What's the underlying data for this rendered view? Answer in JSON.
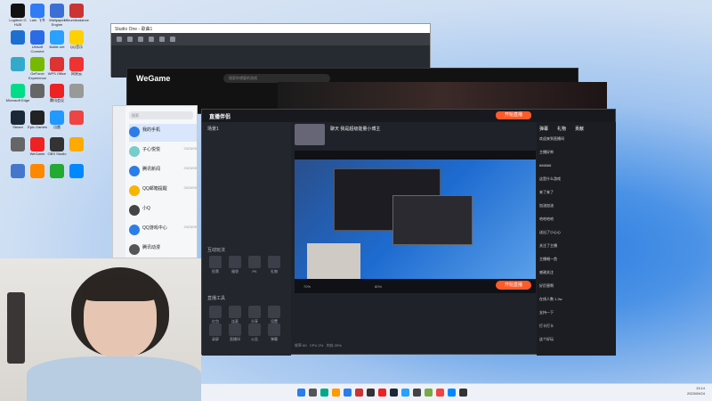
{
  "desktop": {
    "icons": [
      {
        "label": "Logitech G HUB",
        "color": "#111"
      },
      {
        "label": "Lark 飞书",
        "color": "#2f7cf6"
      },
      {
        "label": "Wallpaper Engine",
        "color": "#3b6fd6"
      },
      {
        "label": "Mikumikudance",
        "color": "#c33"
      },
      {
        "label": "",
        "color": "#1f6fd0"
      },
      {
        "label": "Ubisoft Connect",
        "color": "#2b6be6"
      },
      {
        "label": "Battle.net",
        "color": "#2aa0ff"
      },
      {
        "label": "QQ音乐",
        "color": "#ffd100"
      },
      {
        "label": "",
        "color": "#3ac"
      },
      {
        "label": "GeForce Experience",
        "color": "#76b900"
      },
      {
        "label": "WPS Office",
        "color": "#d33"
      },
      {
        "label": "网易云",
        "color": "#e33"
      },
      {
        "label": "Microsoft Edge",
        "color": "#0d8"
      },
      {
        "label": "",
        "color": "#666"
      },
      {
        "label": "腾讯会议",
        "color": "#e22"
      },
      {
        "label": "",
        "color": "#999"
      },
      {
        "label": "Steam",
        "color": "#1b2838"
      },
      {
        "label": "Epic Games",
        "color": "#222"
      },
      {
        "label": "迅雷",
        "color": "#29f"
      },
      {
        "label": "",
        "color": "#e44"
      },
      {
        "label": "",
        "color": "#666"
      },
      {
        "label": "WeGame",
        "color": "#e22"
      },
      {
        "label": "OBS Studio",
        "color": "#333"
      },
      {
        "label": "",
        "color": "#fa0"
      },
      {
        "label": "",
        "color": "#47c"
      },
      {
        "label": "",
        "color": "#f80"
      },
      {
        "label": "",
        "color": "#2a3"
      },
      {
        "label": "",
        "color": "#08f"
      }
    ]
  },
  "studio_one": {
    "title": "Studio One - 歌曲1"
  },
  "wegame": {
    "logo": "WeGame",
    "search_placeholder": "搜索你想要的游戏"
  },
  "qq": {
    "search_placeholder": "搜索",
    "contacts": [
      {
        "name": "我的手机",
        "msg": "",
        "date": "",
        "color": "#2b7de9"
      },
      {
        "name": "子心悦悦",
        "msg": "",
        "date": "2023/09",
        "color": "#7cc"
      },
      {
        "name": "腾讯新闻",
        "msg": "",
        "date": "2023/09",
        "color": "#2b7de9"
      },
      {
        "name": "QQ邮箱提醒",
        "msg": "",
        "date": "2023/09",
        "color": "#f9b400"
      },
      {
        "name": "小Q",
        "msg": "",
        "date": "",
        "color": "#444"
      },
      {
        "name": "QQ游戏中心",
        "msg": "",
        "date": "2023/09",
        "color": "#2b7de9"
      },
      {
        "name": "腾讯动漫",
        "msg": "",
        "date": "",
        "color": "#555"
      }
    ]
  },
  "zhibo": {
    "title": "直播伴侣",
    "live_button": "开始直播",
    "scene_label": "场景1",
    "sections": {
      "interact": "互动玩法",
      "tools": "直播工具"
    },
    "stream_title": "聊天 我是超级能量小博主",
    "preview_caption": "",
    "vol_left": "70%",
    "vol_right": "80%",
    "status": [
      "帧率 60",
      "CPU 2%",
      "内存 20%"
    ],
    "tools": [
      "投票",
      "福袋",
      "PK",
      "礼物",
      "红包",
      "连麦",
      "分享",
      "设置",
      "录屏",
      "直播间",
      "公告",
      "弹幕"
    ],
    "right_tabs": [
      "弹幕",
      "礼物",
      "贡献"
    ],
    "chat": [
      "欢迎来到直播间",
      "主播好帅",
      "666666",
      "这是什么游戏",
      "来了来了",
      "加油加油",
      "哈哈哈哈",
      "送出了小心心",
      "关注了主播",
      "主播唱一首",
      "感谢关注",
      "好厉害啊",
      "在线人数 1.2w",
      "支持一下",
      "打卡打卡",
      "这个好玩"
    ]
  },
  "taskbar": {
    "time": "13:14",
    "date": "2023/09/24"
  }
}
